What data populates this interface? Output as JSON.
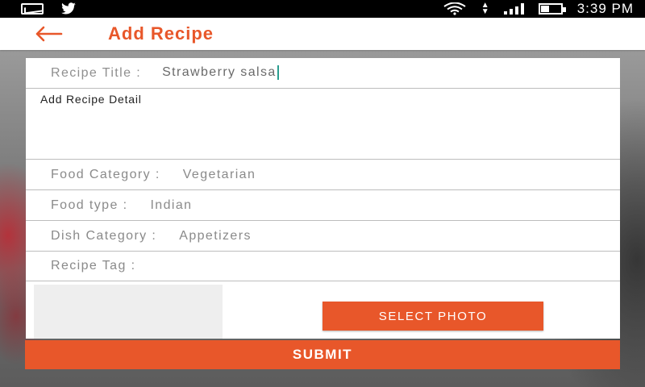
{
  "status_bar": {
    "icons": [
      "mail-icon",
      "twitter-icon",
      "wifi-icon",
      "data-arrows-icon",
      "signal-icon",
      "battery-icon"
    ],
    "time": "3:39 PM"
  },
  "app_bar": {
    "back_icon": "arrow-left-icon",
    "title": "Add Recipe",
    "accent_color": "#e8572a"
  },
  "form": {
    "recipe_title": {
      "label": "Recipe Title :",
      "value": "Strawberry salsa"
    },
    "recipe_detail": {
      "placeholder": "Add Recipe Detail"
    },
    "food_category": {
      "label": "Food Category :",
      "value": "Vegetarian"
    },
    "food_type": {
      "label": "Food type :",
      "value": "Indian"
    },
    "dish_category": {
      "label": "Dish Category :",
      "value": "Appetizers"
    },
    "recipe_tag": {
      "label": "Recipe Tag :",
      "value": ""
    },
    "select_photo_label": "SELECT PHOTO"
  },
  "submit_label": "SUBMIT"
}
